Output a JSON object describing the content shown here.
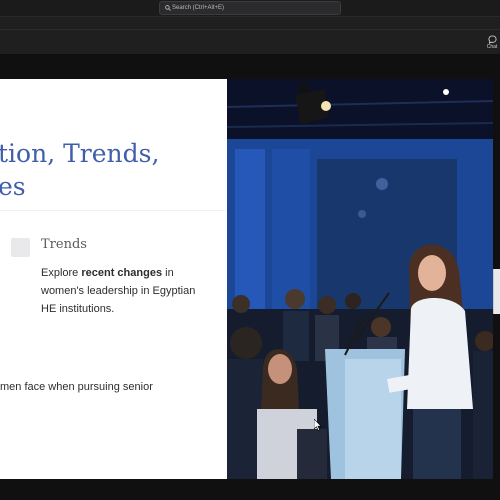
{
  "search": {
    "placeholder": "Search (Ctrl+Alt+E)"
  },
  "appbar": {
    "chat_label": "Chat"
  },
  "slide": {
    "heading_line1": "tion, Trends,",
    "heading_line2": "es",
    "trends": {
      "title": "Trends",
      "body_pre": "Explore ",
      "body_bold": "recent changes",
      "body_post": " in women's leadership in Egyptian HE institutions."
    },
    "challenges_fragment": "men face when pursuing senior"
  },
  "colors": {
    "heading": "#3f5fab",
    "appbar": "#1f1f20",
    "titlebar": "#1b1b1c"
  },
  "icons": {
    "search": "search-icon",
    "chat": "chat-icon",
    "cursor": "mouse-pointer-icon",
    "checkbox": "checkbox-icon"
  }
}
